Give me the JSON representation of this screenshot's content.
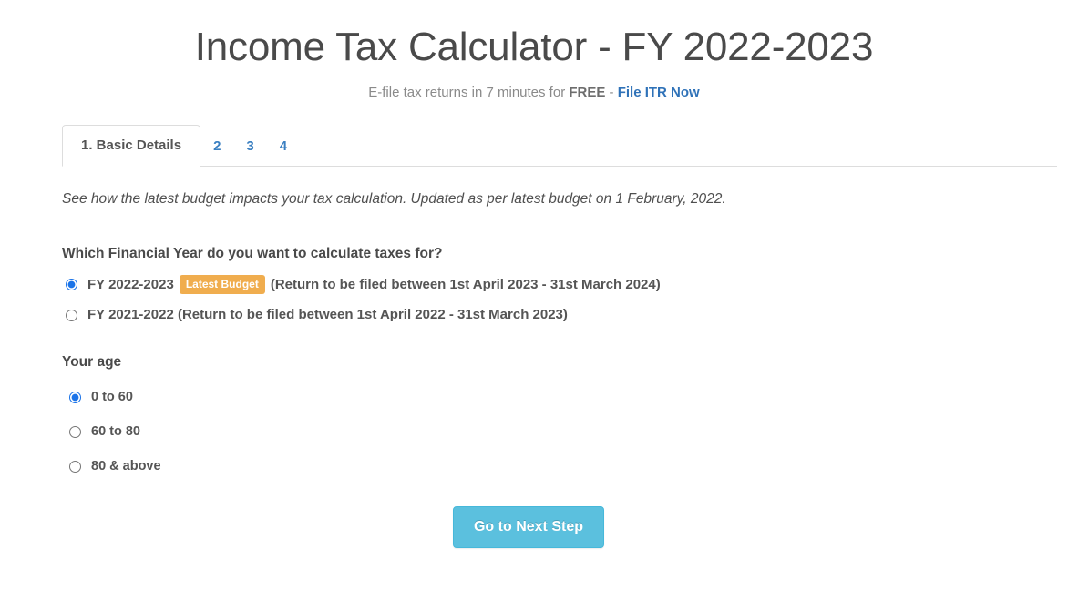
{
  "header": {
    "title": "Income Tax Calculator - FY 2022-2023",
    "subtitle_prefix": "E-file tax returns in 7 minutes for ",
    "subtitle_strong": "FREE",
    "subtitle_dash": " - ",
    "subtitle_link": "File ITR Now"
  },
  "tabs": [
    {
      "label": "1. Basic Details",
      "active": true
    },
    {
      "label": "2",
      "active": false
    },
    {
      "label": "3",
      "active": false
    },
    {
      "label": "4",
      "active": false
    }
  ],
  "main": {
    "budget_note": "See how the latest budget impacts your tax calculation. Updated as per latest budget on 1 February, 2022.",
    "fy_question": "Which Financial Year do you want to calculate taxes for?",
    "fy_options": [
      {
        "name": "FY 2022-2023",
        "badge": "Latest Budget",
        "detail": "(Return to be filed between 1st April 2023 - 31st March 2024)",
        "selected": true
      },
      {
        "name": "FY 2021-2022",
        "badge": "",
        "detail": "(Return to be filed between 1st April 2022 - 31st March 2023)",
        "selected": false
      }
    ],
    "age_question": "Your age",
    "age_options": [
      {
        "label": "0 to 60",
        "selected": true
      },
      {
        "label": "60 to 80",
        "selected": false
      },
      {
        "label": "80 & above",
        "selected": false
      }
    ],
    "next_button": "Go to Next Step"
  },
  "colors": {
    "accent_blue": "#3a7fc1",
    "link_blue": "#2f72b8",
    "badge_orange": "#f0ad4e",
    "button_blue": "#5bc0de",
    "radio_blue": "#1a73e8",
    "text_gray": "#555555",
    "title_gray": "#4a4a4a",
    "border_gray": "#dddddd"
  }
}
